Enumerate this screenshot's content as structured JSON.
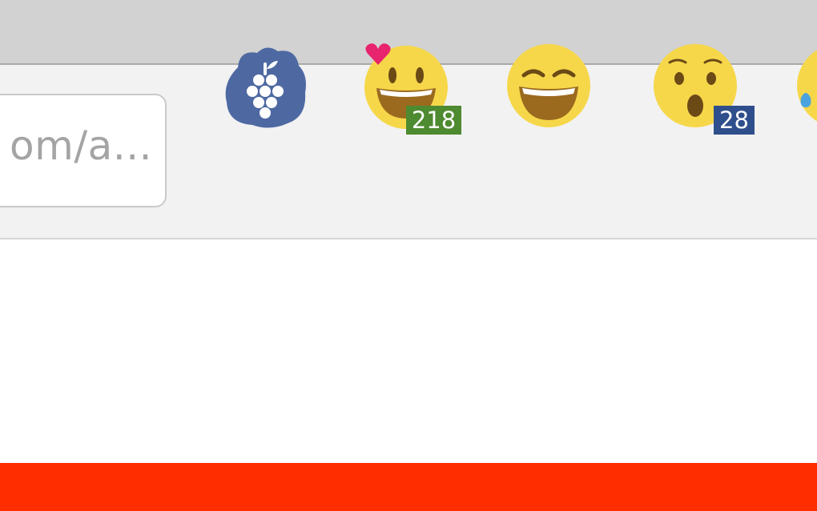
{
  "browser": {
    "url_display": "om/a...",
    "extensions": [
      {
        "name": "grape-extension",
        "icon": "grape-icon",
        "color": "#4e69a2"
      },
      {
        "name": "smiley-heart-extension",
        "icon": "grinning-face-icon",
        "badge": "218",
        "badge_color": "#4e8a30"
      },
      {
        "name": "laughing-extension",
        "icon": "laughing-face-icon"
      },
      {
        "name": "surprised-extension",
        "icon": "surprised-face-icon",
        "badge": "28",
        "badge_color": "#2f4f8c"
      },
      {
        "name": "crying-extension",
        "icon": "crying-face-icon"
      }
    ]
  },
  "page": {
    "accent_color": "#ff2d00"
  }
}
